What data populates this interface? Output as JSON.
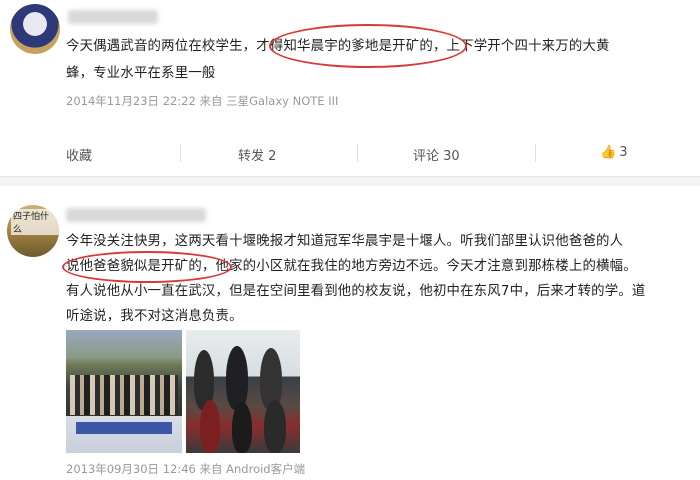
{
  "posts": [
    {
      "text_lines": [
        "今天偶遇武音的两位在校学生，才得知华晨宇的爹地是开矿的，上下学开个四十来万的大黄",
        "蜂，专业水平在系里一般"
      ],
      "meta": "2014年11月23日 22:22 来自 三星Galaxy NOTE III",
      "actions": {
        "favorite": "收藏",
        "repost": "转发 2",
        "comment": "评论 30",
        "like_count": "3"
      }
    },
    {
      "avatar_text": "四子怕什么",
      "text_lines": [
        "今年没关注快男，这两天看十堰晚报才知道冠军华晨宇是十堰人。听我们部里认识他爸爸的人",
        "说他爸爸貌似是开矿的，他家的小区就在我住的地方旁边不远。今天才注意到那栋楼上的横幅。",
        "有人说他从小一直在武汉，但是在空间里看到他的校友说，他初中在东风7中，后来才转的学。道",
        "听途说，我不对这消息负责。"
      ],
      "meta": "2013年09月30日 12:46 来自 Android客户端"
    }
  ],
  "icons": {
    "like": "thumbs-up-icon"
  },
  "colors": {
    "highlight_oval": "#d63a3a",
    "meta_text": "#999999",
    "background": "#f3f3f3"
  }
}
